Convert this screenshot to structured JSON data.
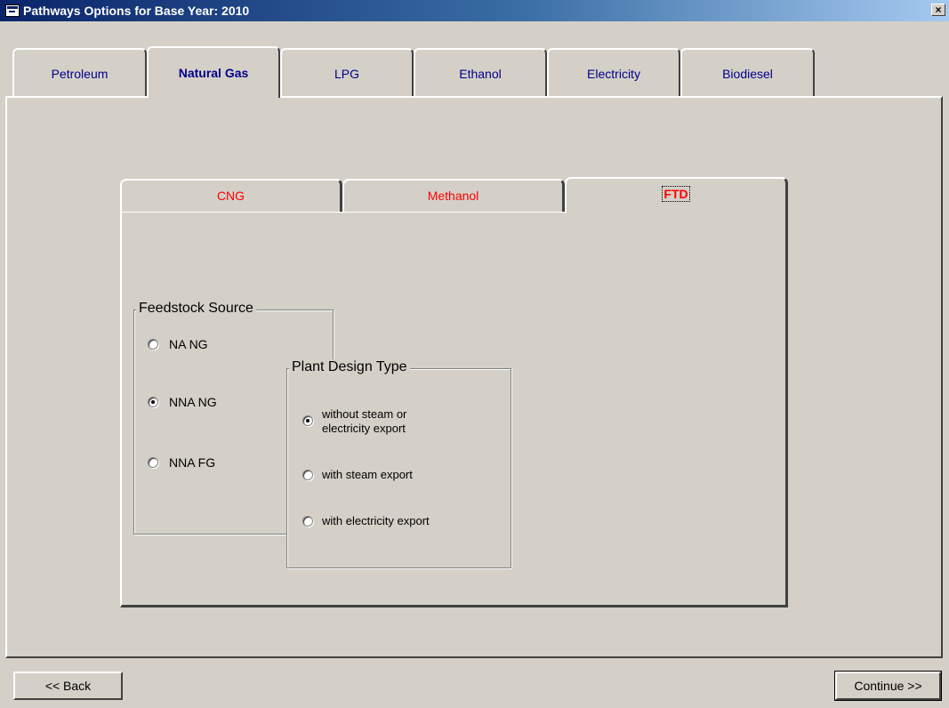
{
  "window": {
    "title": "Pathways Options for Base Year: 2010",
    "close_glyph": "×"
  },
  "outer_tabs": [
    {
      "label": "Petroleum",
      "active": false
    },
    {
      "label": "Natural Gas",
      "active": true
    },
    {
      "label": "LPG",
      "active": false
    },
    {
      "label": "Ethanol",
      "active": false
    },
    {
      "label": "Electricity",
      "active": false
    },
    {
      "label": "Biodiesel",
      "active": false
    }
  ],
  "inner_tabs": [
    {
      "label": "CNG",
      "active": false
    },
    {
      "label": "Methanol",
      "active": false
    },
    {
      "label": "FTD",
      "active": true
    }
  ],
  "feedstock": {
    "legend": "Feedstock Source",
    "options": [
      {
        "label": "NA NG",
        "checked": false
      },
      {
        "label": "NNA NG",
        "checked": true
      },
      {
        "label": "NNA FG",
        "checked": false
      }
    ]
  },
  "plant_design": {
    "legend": "Plant Design Type",
    "options": [
      {
        "label_line1": "without steam or",
        "label_line2": "electricity export",
        "checked": true
      },
      {
        "label": "with steam export",
        "checked": false
      },
      {
        "label": "with electricity export",
        "checked": false
      }
    ]
  },
  "buttons": {
    "back": "<< Back",
    "continue": "Continue >>"
  },
  "colors": {
    "title_start": "#0a246a",
    "tab_text": "#00008b",
    "inner_tab_text": "#ff0000",
    "face": "#d4d0c8"
  }
}
